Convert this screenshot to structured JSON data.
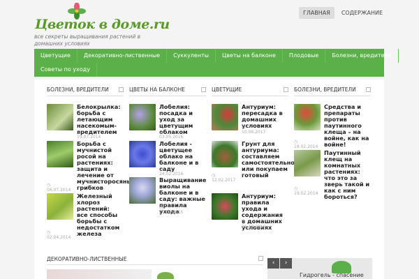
{
  "site": {
    "logo_text": "Цветок в доме.ru",
    "tagline": "все секреты выращивания растений в домашних условиях"
  },
  "topnav": [
    {
      "label": "ГЛАВНАЯ"
    },
    {
      "label": "СОДЕРЖАНИЕ"
    }
  ],
  "menu": {
    "row1": [
      "Цветущие",
      "Декоративно-лиственные",
      "Суккуленты",
      "Цветы на балконе",
      "Плодовые",
      "Болезни, вредители"
    ],
    "row2": [
      "Советы по уходу"
    ]
  },
  "columns": [
    {
      "title": "БОЛЕЗНИ, ВРЕДИТЕЛИ",
      "posts": [
        {
          "title": "Белокрылка: борьба с летающим насекомым-вредителем",
          "date": "19.07.2014"
        },
        {
          "title": "Борьба с мучнистой росой на растениях: защита и лечение от мучнисторосяных грибков",
          "date": "06.07.2014"
        },
        {
          "title": "Железный хлороз растений: все способы борьбы с недостатком железа",
          "date": "02.04.2014"
        }
      ]
    },
    {
      "title": "ЦВЕТЫ НА БАЛКОНЕ",
      "posts": [
        {
          "title": "Лобелия: посадка и уход за цветущим облаком",
          "date": "03.05.2016"
        },
        {
          "title": "Лобелия - цветущее облако на балконе и в саду",
          "date": "24.02.2016"
        },
        {
          "title": "Выращивание виолы на балконе и в саду: важные правила ухода",
          "date": "20.04.2015"
        }
      ]
    },
    {
      "title": "ЦВЕТУЩИЕ",
      "posts": [
        {
          "title": "Антуриум: пересадка в домашних условиях",
          "date": "10.06.2017"
        },
        {
          "title": "Грунт для антуриума: составляем самостоятельно или покупаем готовый",
          "date": "12.02.2017"
        },
        {
          "title": "Антуриум: правила ухода и содержания в домашних условиях",
          "date": "21.10.2016"
        }
      ]
    },
    {
      "title": "БОЛЕЗНИ, ВРЕДИТЕЛИ",
      "posts": [
        {
          "title": "Средства и препараты против паутинного клеща – на войне, как на войне!",
          "date": "18.02.2014"
        },
        {
          "title": "Паутинный клещ на комнатных растениях: что это за зверь такой и как с ним бороться?",
          "date": "19.02.2014"
        }
      ]
    }
  ],
  "bottom": {
    "section_title": "ДЕКОРАТИВНО-ЛИСТВЕННЫЕ",
    "slider_caption": "Гидрогель - спасение"
  },
  "colors": {
    "menu_green": "#5cb04a",
    "logo_green": "#5a9a2a"
  }
}
